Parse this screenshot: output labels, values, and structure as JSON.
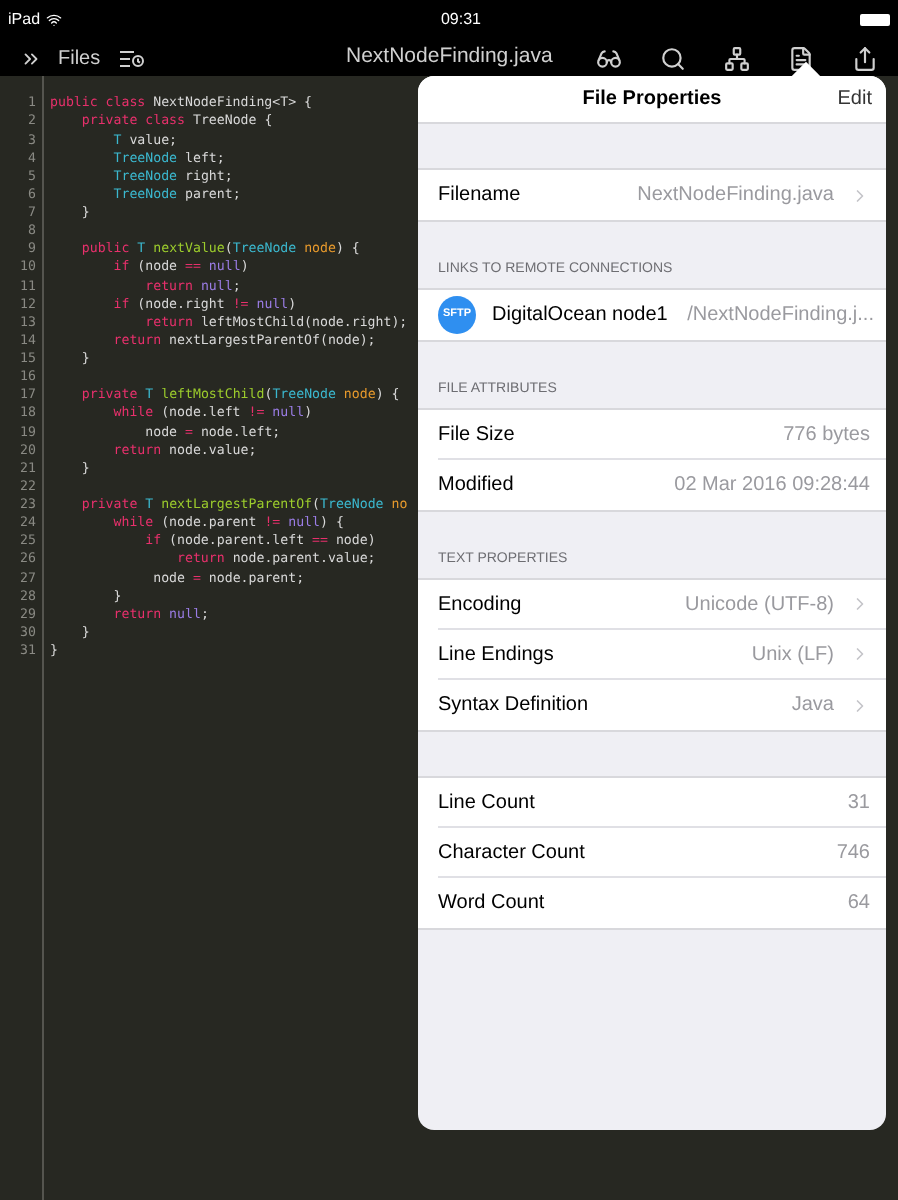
{
  "status_bar": {
    "device": "iPad",
    "time": "09:31"
  },
  "toolbar": {
    "files_button": "Files",
    "title": "NextNodeFinding.java"
  },
  "editor": {
    "lines": [
      {
        "number": "1",
        "tokens": [
          {
            "text": "public class ",
            "kind": "keyword"
          },
          {
            "text": "NextNodeFinding<T> {",
            "kind": "plain"
          }
        ]
      },
      {
        "number": "2",
        "tokens": [
          {
            "text": "    private class ",
            "kind": "keyword"
          },
          {
            "text": "TreeNode {",
            "kind": "plain"
          }
        ]
      },
      {
        "number": "3",
        "tokens": [
          {
            "text": "        T",
            "kind": "type"
          },
          {
            "text": " value;",
            "kind": "plain"
          }
        ]
      },
      {
        "number": "4",
        "tokens": [
          {
            "text": "        TreeNode",
            "kind": "type"
          },
          {
            "text": " left;",
            "kind": "plain"
          }
        ]
      },
      {
        "number": "5",
        "tokens": [
          {
            "text": "        TreeNode",
            "kind": "type"
          },
          {
            "text": " right;",
            "kind": "plain"
          }
        ]
      },
      {
        "number": "6",
        "tokens": [
          {
            "text": "        TreeNode",
            "kind": "type"
          },
          {
            "text": " parent;",
            "kind": "plain"
          }
        ]
      },
      {
        "number": "7",
        "tokens": [
          {
            "text": "    }",
            "kind": "plain"
          }
        ]
      },
      {
        "number": "8"
      },
      {
        "number": "9",
        "tokens": [
          {
            "text": "    public ",
            "kind": "keyword"
          },
          {
            "text": "T ",
            "kind": "type"
          },
          {
            "text": "nextValue",
            "kind": "function"
          },
          {
            "text": "(",
            "kind": "plain"
          },
          {
            "text": "TreeNode ",
            "kind": "type"
          },
          {
            "text": "node",
            "kind": "param"
          },
          {
            "text": ") {",
            "kind": "plain"
          }
        ]
      },
      {
        "number": "10",
        "tokens": [
          {
            "text": "        if",
            "kind": "keyword"
          },
          {
            "text": " (node ",
            "kind": "plain"
          },
          {
            "text": "== ",
            "kind": "operator"
          },
          {
            "text": "null",
            "kind": "null"
          },
          {
            "text": ")",
            "kind": "plain"
          }
        ]
      },
      {
        "number": "11",
        "tokens": [
          {
            "text": "            return ",
            "kind": "keyword"
          },
          {
            "text": "null",
            "kind": "null"
          },
          {
            "text": ";",
            "kind": "plain"
          }
        ]
      },
      {
        "number": "12",
        "tokens": [
          {
            "text": "        if",
            "kind": "keyword"
          },
          {
            "text": " (node.right ",
            "kind": "plain"
          },
          {
            "text": "!= ",
            "kind": "operator"
          },
          {
            "text": "null",
            "kind": "null"
          },
          {
            "text": ")",
            "kind": "plain"
          }
        ]
      },
      {
        "number": "13",
        "tokens": [
          {
            "text": "            return",
            "kind": "keyword"
          },
          {
            "text": " leftMostChild(node.right);",
            "kind": "plain"
          }
        ]
      },
      {
        "number": "14",
        "tokens": [
          {
            "text": "        return",
            "kind": "keyword"
          },
          {
            "text": " nextLargestParentOf(node);",
            "kind": "plain"
          }
        ]
      },
      {
        "number": "15",
        "tokens": [
          {
            "text": "    }",
            "kind": "plain"
          }
        ]
      },
      {
        "number": "16"
      },
      {
        "number": "17",
        "tokens": [
          {
            "text": "    private ",
            "kind": "keyword"
          },
          {
            "text": "T ",
            "kind": "type"
          },
          {
            "text": "leftMostChild",
            "kind": "function"
          },
          {
            "text": "(",
            "kind": "plain"
          },
          {
            "text": "TreeNode ",
            "kind": "type"
          },
          {
            "text": "node",
            "kind": "param"
          },
          {
            "text": ") {",
            "kind": "plain"
          }
        ]
      },
      {
        "number": "18",
        "tokens": [
          {
            "text": "        while",
            "kind": "keyword"
          },
          {
            "text": " (node.left ",
            "kind": "plain"
          },
          {
            "text": "!= ",
            "kind": "operator"
          },
          {
            "text": "null",
            "kind": "null"
          },
          {
            "text": ")",
            "kind": "plain"
          }
        ]
      },
      {
        "number": "19",
        "tokens": [
          {
            "text": "            node ",
            "kind": "plain"
          },
          {
            "text": "=",
            "kind": "operator"
          },
          {
            "text": " node.left;",
            "kind": "plain"
          }
        ]
      },
      {
        "number": "20",
        "tokens": [
          {
            "text": "        return",
            "kind": "keyword"
          },
          {
            "text": " node.value;",
            "kind": "plain"
          }
        ]
      },
      {
        "number": "21",
        "tokens": [
          {
            "text": "    }",
            "kind": "plain"
          }
        ]
      },
      {
        "number": "22"
      },
      {
        "number": "23",
        "tokens": [
          {
            "text": "    private ",
            "kind": "keyword"
          },
          {
            "text": "T ",
            "kind": "type"
          },
          {
            "text": "nextLargestParentOf",
            "kind": "function"
          },
          {
            "text": "(",
            "kind": "plain"
          },
          {
            "text": "TreeNode ",
            "kind": "type"
          },
          {
            "text": "no",
            "kind": "param"
          }
        ]
      },
      {
        "number": "24",
        "tokens": [
          {
            "text": "        while",
            "kind": "keyword"
          },
          {
            "text": " (node.parent ",
            "kind": "plain"
          },
          {
            "text": "!= ",
            "kind": "operator"
          },
          {
            "text": "null",
            "kind": "null"
          },
          {
            "text": ") {",
            "kind": "plain"
          }
        ]
      },
      {
        "number": "25",
        "tokens": [
          {
            "text": "            if",
            "kind": "keyword"
          },
          {
            "text": " (node.parent.left ",
            "kind": "plain"
          },
          {
            "text": "==",
            "kind": "operator"
          },
          {
            "text": " node)",
            "kind": "plain"
          }
        ]
      },
      {
        "number": "26",
        "tokens": [
          {
            "text": "                return",
            "kind": "keyword"
          },
          {
            "text": " node.parent.value;",
            "kind": "plain"
          }
        ]
      },
      {
        "number": "27",
        "tokens": [
          {
            "text": "             node ",
            "kind": "plain"
          },
          {
            "text": "=",
            "kind": "operator"
          },
          {
            "text": " node.parent;",
            "kind": "plain"
          }
        ]
      },
      {
        "number": "28",
        "tokens": [
          {
            "text": "        }",
            "kind": "plain"
          }
        ]
      },
      {
        "number": "29",
        "tokens": [
          {
            "text": "        return ",
            "kind": "keyword"
          },
          {
            "text": "null",
            "kind": "null"
          },
          {
            "text": ";",
            "kind": "plain"
          }
        ]
      },
      {
        "number": "30",
        "tokens": [
          {
            "text": "    }",
            "kind": "plain"
          }
        ]
      },
      {
        "number": "31",
        "tokens": [
          {
            "text": "}",
            "kind": "plain"
          }
        ]
      }
    ]
  },
  "popover": {
    "title": "File Properties",
    "edit_button": "Edit",
    "sections": [
      {
        "rows": [
          {
            "kind": "disclosure",
            "label": "Filename",
            "value": "NextNodeFinding.java"
          }
        ]
      },
      {
        "header": "LINKS TO REMOTE CONNECTIONS",
        "rows": [
          {
            "kind": "connection",
            "badge": "SFTP",
            "label": "DigitalOcean node1",
            "value": "/NextNodeFinding.j..."
          }
        ]
      },
      {
        "header": "FILE ATTRIBUTES",
        "rows": [
          {
            "kind": "value",
            "label": "File Size",
            "value": "776 bytes"
          },
          {
            "kind": "value",
            "label": "Modified",
            "value": "02 Mar 2016 09:28:44"
          }
        ]
      },
      {
        "header": "TEXT PROPERTIES",
        "rows": [
          {
            "kind": "disclosure",
            "label": "Encoding",
            "value": "Unicode (UTF-8)"
          },
          {
            "kind": "disclosure",
            "label": "Line Endings",
            "value": "Unix (LF)"
          },
          {
            "kind": "disclosure",
            "label": "Syntax Definition",
            "value": "Java"
          }
        ]
      },
      {
        "rows": [
          {
            "kind": "value",
            "label": "Line Count",
            "value": "31"
          },
          {
            "kind": "value",
            "label": "Character Count",
            "value": "746"
          },
          {
            "kind": "value",
            "label": "Word Count",
            "value": "64"
          }
        ]
      }
    ]
  }
}
